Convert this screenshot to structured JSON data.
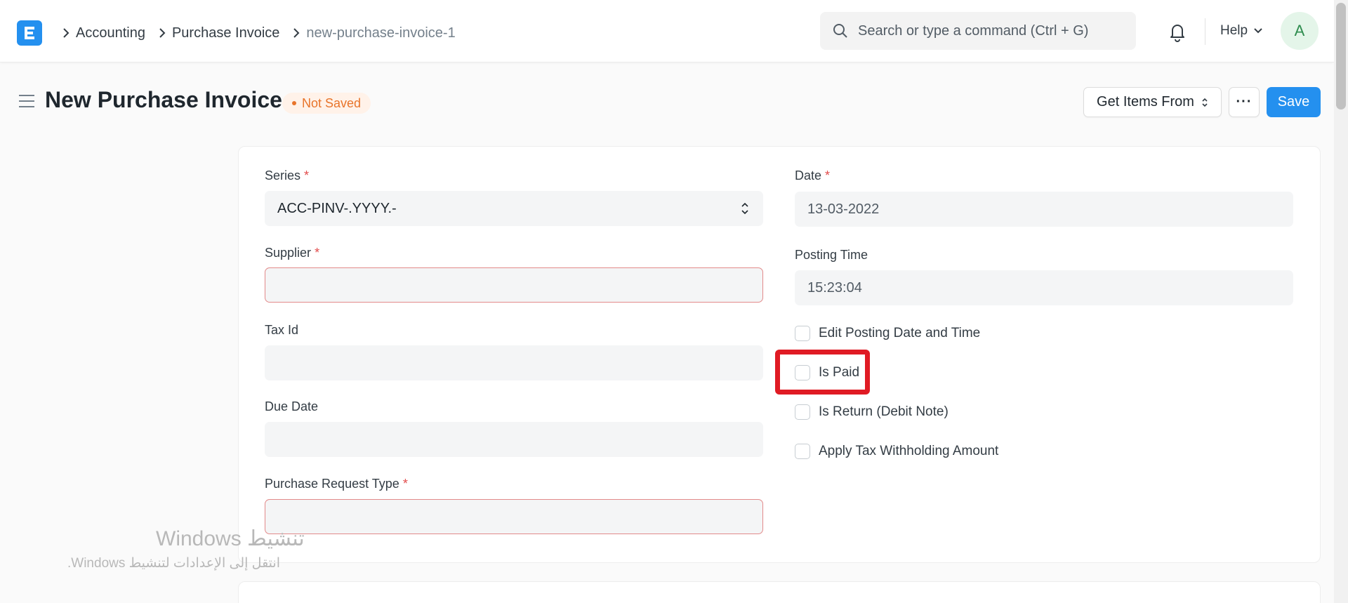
{
  "navbar": {
    "logo_letter": "E",
    "breadcrumb": [
      "Accounting",
      "Purchase Invoice",
      "new-purchase-invoice-1"
    ],
    "search_placeholder": "Search or type a command (Ctrl + G)",
    "help_label": "Help",
    "avatar_initial": "A"
  },
  "page_head": {
    "title": "New Purchase Invoice",
    "status": "Not Saved",
    "get_items_label": "Get Items From",
    "more_label": "···",
    "save_label": "Save"
  },
  "form": {
    "series": {
      "label": "Series",
      "required": "*",
      "value": "ACC-PINV-.YYYY.-"
    },
    "supplier": {
      "label": "Supplier",
      "required": "*",
      "value": ""
    },
    "tax_id": {
      "label": "Tax Id",
      "value": ""
    },
    "due_date": {
      "label": "Due Date",
      "value": ""
    },
    "purchase_request_type": {
      "label": "Purchase Request Type",
      "required": "*",
      "value": ""
    },
    "date": {
      "label": "Date",
      "required": "*",
      "value": "13-03-2022"
    },
    "posting_time": {
      "label": "Posting Time",
      "value": "15:23:04"
    },
    "checkboxes": [
      {
        "label": "Edit Posting Date and Time",
        "checked": false
      },
      {
        "label": "Is Paid",
        "checked": false
      },
      {
        "label": "Is Return (Debit Note)",
        "checked": false
      },
      {
        "label": "Apply Tax Withholding Amount",
        "checked": false
      }
    ]
  },
  "watermark": {
    "title": "تنشيط Windows",
    "subtitle": "انتقل إلى الإعدادات لتنشيط Windows."
  },
  "colors": {
    "accent": "#2490ef",
    "status_orange": "#e8742a",
    "required_red": "#e24c4c",
    "annotation_red": "#e01b24"
  }
}
